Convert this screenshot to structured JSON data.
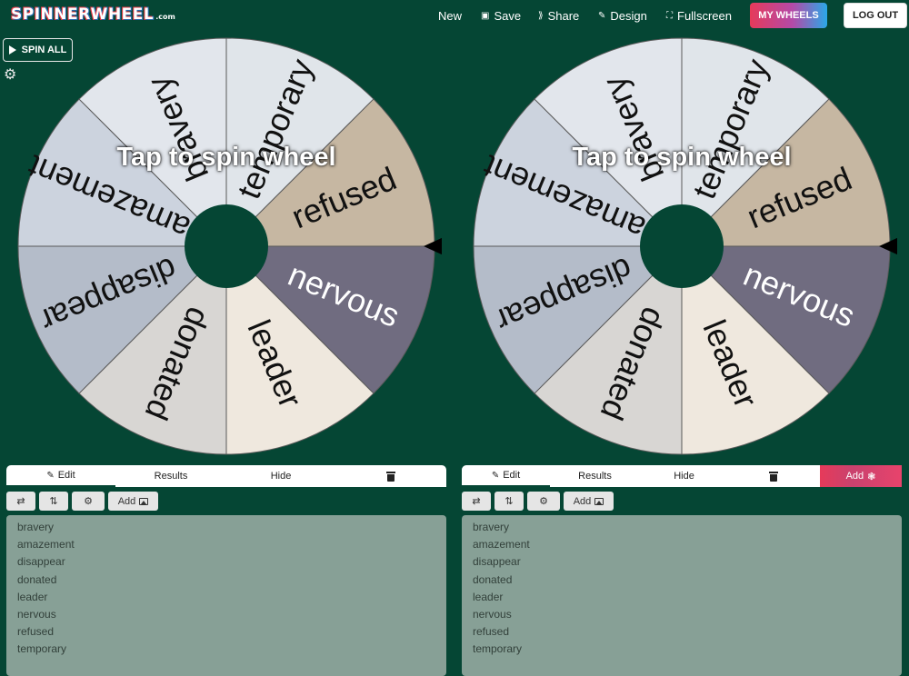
{
  "header": {
    "logo": "SPINNERWHEEL",
    "logo_suffix": ".com",
    "nav": {
      "new": "New",
      "save": "Save",
      "share": "Share",
      "design": "Design",
      "fullscreen": "Fullscreen"
    },
    "my_wheels": "MY WHEELS",
    "logout": "LOG OUT"
  },
  "spin_all": "SPIN ALL",
  "wheels": [
    {
      "overlay": "Tap to spin wheel",
      "segments": [
        {
          "label": "temporary",
          "color": "#e0e5ea"
        },
        {
          "label": "refused",
          "color": "#c6b7a2"
        },
        {
          "label": "nervous",
          "color": "#706c80"
        },
        {
          "label": "leader",
          "color": "#efe8de"
        },
        {
          "label": "donated",
          "color": "#d8d6d3"
        },
        {
          "label": "disappear",
          "color": "#b4bcc9"
        },
        {
          "label": "amazement",
          "color": "#ccd3de"
        },
        {
          "label": "bravery",
          "color": "#e2e6ec"
        }
      ]
    },
    {
      "overlay": "Tap to spin wheel",
      "segments": [
        {
          "label": "temporary",
          "color": "#e0e5ea"
        },
        {
          "label": "refused",
          "color": "#c6b7a2"
        },
        {
          "label": "nervous",
          "color": "#706c80"
        },
        {
          "label": "leader",
          "color": "#efe8de"
        },
        {
          "label": "donated",
          "color": "#d8d6d3"
        },
        {
          "label": "disappear",
          "color": "#b4bcc9"
        },
        {
          "label": "amazement",
          "color": "#ccd3de"
        },
        {
          "label": "bravery",
          "color": "#e2e6ec"
        }
      ]
    }
  ],
  "panels": [
    {
      "tabs": {
        "edit": "Edit",
        "results": "Results",
        "hide": "Hide"
      },
      "tools": {
        "add": "Add"
      },
      "entries": [
        "bravery",
        "amazement",
        "disappear",
        "donated",
        "leader",
        "nervous",
        "refused",
        "temporary"
      ]
    },
    {
      "tabs": {
        "edit": "Edit",
        "results": "Results",
        "hide": "Hide",
        "add": "Add"
      },
      "tools": {
        "add": "Add"
      },
      "entries": [
        "bravery",
        "amazement",
        "disappear",
        "donated",
        "leader",
        "nervous",
        "refused",
        "temporary"
      ]
    }
  ],
  "colors": {
    "background": "#054634",
    "hub": "#054634",
    "entries_bg": "#87a096",
    "pointer": "#000000"
  }
}
